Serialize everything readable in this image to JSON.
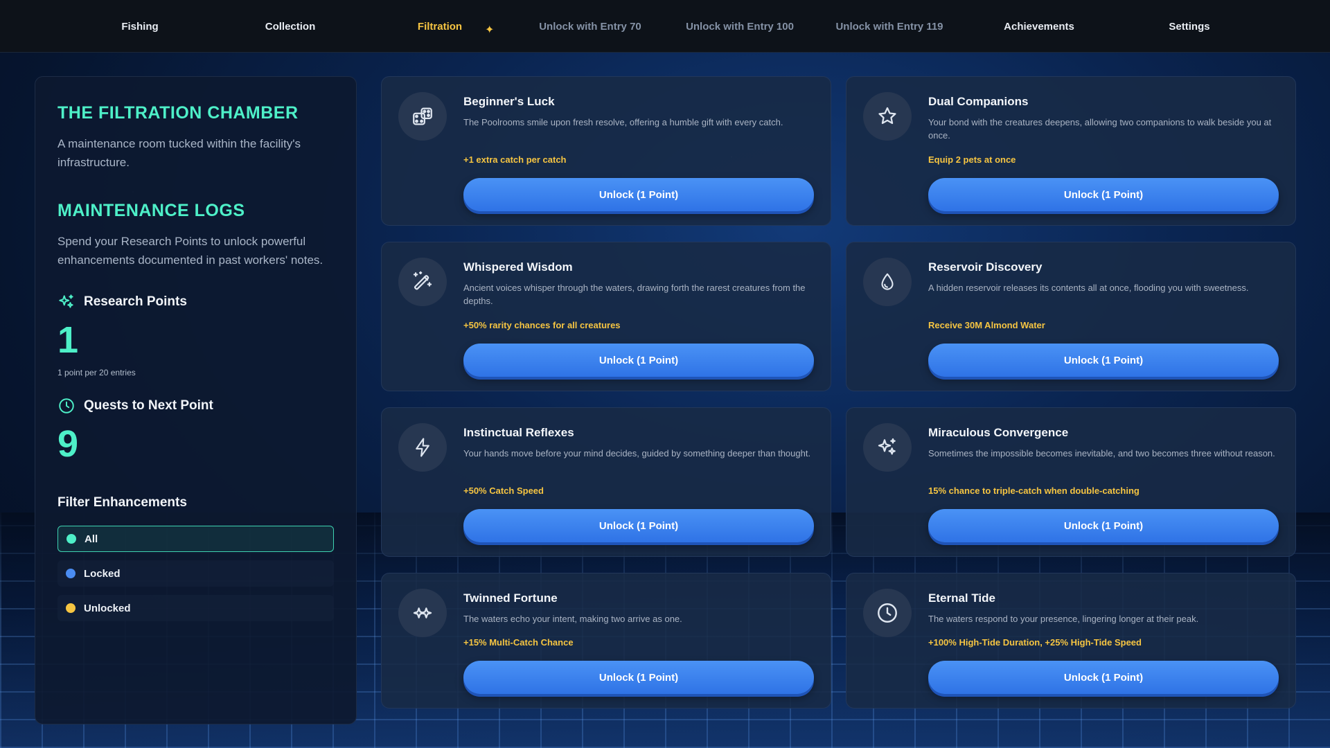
{
  "nav": [
    {
      "label": "Fishing",
      "state": "normal"
    },
    {
      "label": "Collection",
      "state": "normal"
    },
    {
      "label": "Filtration",
      "state": "active"
    },
    {
      "label": "Unlock with Entry 70",
      "state": "dim"
    },
    {
      "label": "Unlock with Entry 100",
      "state": "dim"
    },
    {
      "label": "Unlock with Entry 119",
      "state": "dim"
    },
    {
      "label": "Achievements",
      "state": "normal"
    },
    {
      "label": "Settings",
      "state": "normal"
    }
  ],
  "left": {
    "title": "THE FILTRATION CHAMBER",
    "desc": "A maintenance room tucked within the facility's infrastructure.",
    "logs_title": "MAINTENANCE LOGS",
    "logs_desc": "Spend your Research Points to unlock powerful enhancements documented in past workers' notes.",
    "research_label": "Research Points",
    "research_value": "1",
    "research_note": "1 point per 20 entries",
    "quests_label": "Quests to Next Point",
    "quests_value": "9",
    "filter_title": "Filter Enhancements",
    "filters": [
      {
        "label": "All",
        "color": "#4ef0c8",
        "active": true
      },
      {
        "label": "Locked",
        "color": "#4a8cf2",
        "active": false
      },
      {
        "label": "Unlocked",
        "color": "#f6c542",
        "active": false
      }
    ]
  },
  "cards": [
    {
      "title": "Beginner's Luck",
      "desc": "The Poolrooms smile upon fresh resolve, offering a humble gift with every catch.",
      "effect": "+1 extra catch per catch",
      "button": "Unlock (1 Point)",
      "icon": "dice-icon"
    },
    {
      "title": "Dual Companions",
      "desc": "Your bond with the creatures deepens, allowing two companions to walk beside you at once.",
      "effect": "Equip 2 pets at once",
      "button": "Unlock (1 Point)",
      "icon": "star-icon"
    },
    {
      "title": "Whispered Wisdom",
      "desc": "Ancient voices whisper through the waters, drawing forth the rarest creatures from the depths.",
      "effect": "+50% rarity chances for all creatures",
      "button": "Unlock (1 Point)",
      "icon": "magic-wand-icon"
    },
    {
      "title": "Reservoir Discovery",
      "desc": "A hidden reservoir releases its contents all at once, flooding you with sweetness.",
      "effect": "Receive 30M Almond Water",
      "button": "Unlock (1 Point)",
      "icon": "droplet-icon"
    },
    {
      "title": "Instinctual Reflexes",
      "desc": "Your hands move before your mind decides, guided by something deeper than thought.",
      "effect": "+50% Catch Speed",
      "button": "Unlock (1 Point)",
      "icon": "lightning-icon"
    },
    {
      "title": "Miraculous Convergence",
      "desc": "Sometimes the impossible becomes inevitable, and two becomes three without reason.",
      "effect": "15% chance to triple-catch when double-catching",
      "button": "Unlock (1 Point)",
      "icon": "sparkles-icon"
    },
    {
      "title": "Twinned Fortune",
      "desc": "The waters echo your intent, making two arrive as one.",
      "effect": "+15% Multi-Catch Chance",
      "button": "Unlock (1 Point)",
      "icon": "twin-sparkle-icon"
    },
    {
      "title": "Eternal Tide",
      "desc": "The waters respond to your presence, lingering longer at their peak.",
      "effect": "+100% High-Tide Duration, +25% High-Tide Speed",
      "button": "Unlock (1 Point)",
      "icon": "clock-icon"
    }
  ]
}
